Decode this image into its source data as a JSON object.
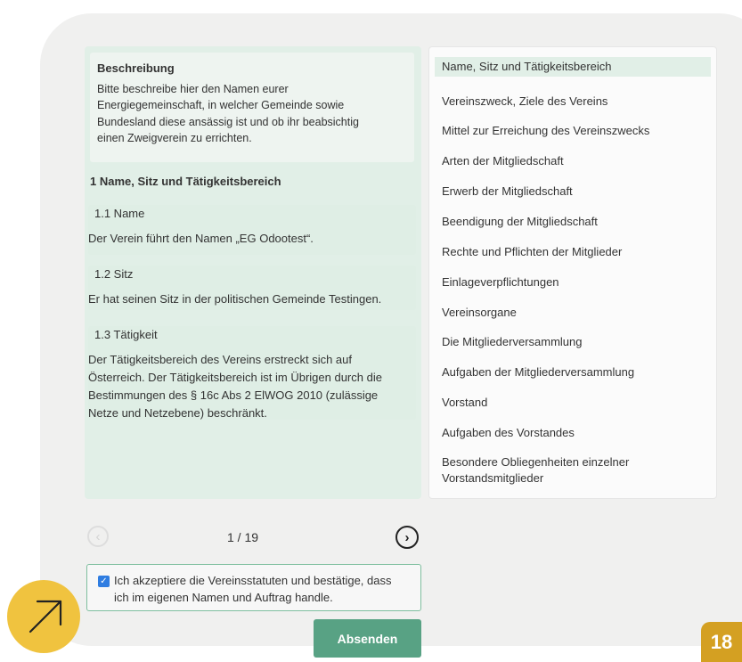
{
  "description": {
    "title": "Beschreibung",
    "lines": [
      "Bitte beschreibe hier den Namen eurer",
      "Energiegemeinschaft, in welcher Gemeinde sowie",
      "Bundesland diese ansässig ist und ob ihr beabsichtig",
      "einen Zweigverein zu errichten."
    ]
  },
  "section": {
    "title": "1 Name, Sitz und Tätigkeitsbereich",
    "subsections": [
      {
        "heading": "1.1  Name",
        "body": [
          "Der Verein führt den Namen „EG Odootest“."
        ]
      },
      {
        "heading": "1.2  Sitz",
        "body": [
          "Er hat seinen Sitz in der politischen Gemeinde Testingen."
        ]
      },
      {
        "heading": "1.3  Tätigkeit",
        "body": [
          "Der Tätigkeitsbereich des Vereins erstreckt sich auf",
          "Österreich. Der Tätigkeitsbereich ist im Übrigen durch die",
          "Bestimmungen des § 16c Abs 2 ElWOG 2010 (zulässige",
          "Netze und Netzebene) beschränkt."
        ]
      }
    ]
  },
  "toc": {
    "items": [
      "Name, Sitz und Tätigkeitsbereich",
      "Vereinszweck, Ziele des Vereins",
      "Mittel zur Erreichung des Vereinszwecks",
      "Arten der Mitgliedschaft",
      "Erwerb der Mitgliedschaft",
      "Beendigung der Mitgliedschaft",
      "Rechte und Pflichten der Mitglieder",
      "Einlageverpflichtungen",
      "Vereinsorgane",
      "Die Mitgliederversammlung",
      "Aufgaben der Mitgliederversammlung",
      "Vorstand",
      "Aufgaben des Vorstandes",
      "Besondere Obliegenheiten einzelner",
      "Vorstandsmitglieder"
    ],
    "active_index": 0
  },
  "pager": {
    "label": "1 / 19",
    "prev_icon": "chevron-left-icon",
    "next_icon": "chevron-right-icon"
  },
  "accept": {
    "checked": true,
    "lines": [
      "Ich akzeptiere die Vereinsstatuten und bestätige, dass",
      "ich im eigenen Namen und Auftrag handle."
    ]
  },
  "submit_label": "Absenden",
  "step_badge": "18",
  "colors": {
    "accent_green": "#58a284",
    "panel_green": "#e1efe7",
    "badge_yellow": "#f0c33f",
    "badge_gold": "#d4a022",
    "checkbox_blue": "#2f7de1"
  }
}
